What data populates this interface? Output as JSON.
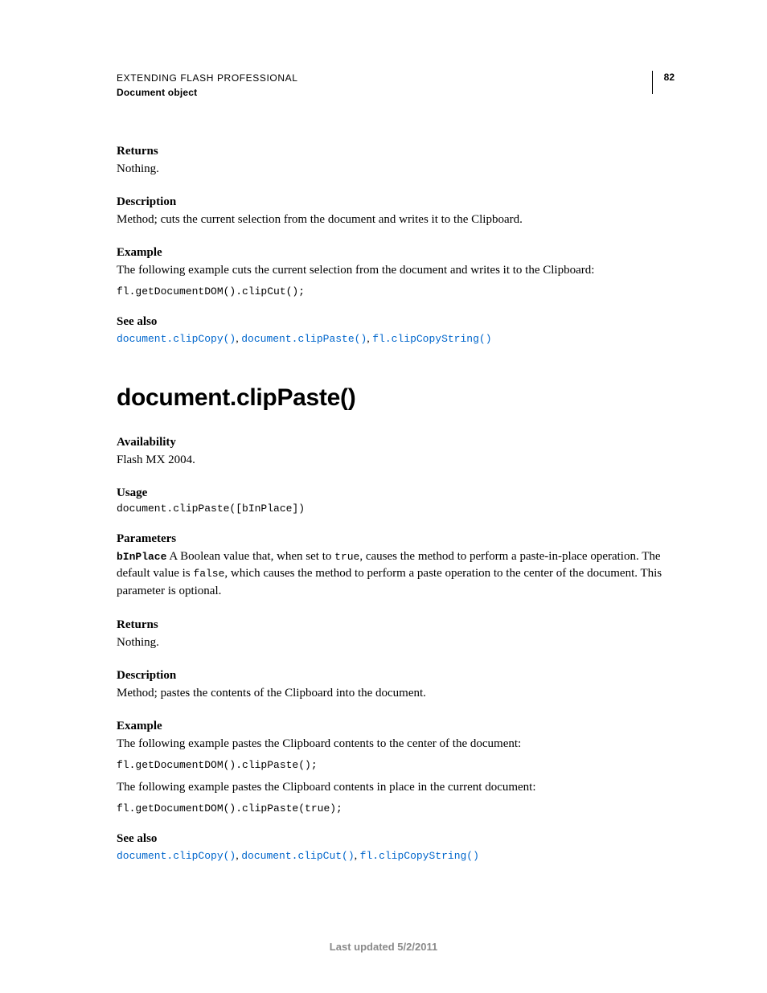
{
  "header": {
    "title": "EXTENDING FLASH PROFESSIONAL",
    "section": "Document object",
    "page_number": "82"
  },
  "section1": {
    "returns_h": "Returns",
    "returns_body": "Nothing.",
    "description_h": "Description",
    "description_body": "Method; cuts the current selection from the document and writes it to the Clipboard.",
    "example_h": "Example",
    "example_intro": "The following example cuts the current selection from the document and writes it to the Clipboard:",
    "example_code": "fl.getDocumentDOM().clipCut();",
    "seealso_h": "See also",
    "seealso_links": {
      "a": "document.clipCopy()",
      "b": "document.clipPaste()",
      "c": "fl.clipCopyString()"
    }
  },
  "main_heading": "document.clipPaste()",
  "section2": {
    "availability_h": "Availability",
    "availability_body": "Flash MX 2004.",
    "usage_h": "Usage",
    "usage_code": "document.clipPaste([bInPlace])",
    "parameters_h": "Parameters",
    "param_name": "bInPlace",
    "param_text_1": "  A Boolean value that, when set to ",
    "param_code_true": "true",
    "param_text_2": ", causes the method to perform a paste-in-place operation. The default value is ",
    "param_code_false": "false",
    "param_text_3": ", which causes the method to perform a paste operation to the center of the document. This parameter is optional.",
    "returns_h": "Returns",
    "returns_body": "Nothing.",
    "description_h": "Description",
    "description_body": "Method; pastes the contents of the Clipboard into the document.",
    "example_h": "Example",
    "example_intro_1": "The following example pastes the Clipboard contents to the center of the document:",
    "example_code_1": "fl.getDocumentDOM().clipPaste();",
    "example_intro_2": "The following example pastes the Clipboard contents in place in the current document:",
    "example_code_2": "fl.getDocumentDOM().clipPaste(true);",
    "seealso_h": "See also",
    "seealso_links": {
      "a": "document.clipCopy()",
      "b": "document.clipCut()",
      "c": "fl.clipCopyString()"
    }
  },
  "footer": "Last updated 5/2/2011"
}
